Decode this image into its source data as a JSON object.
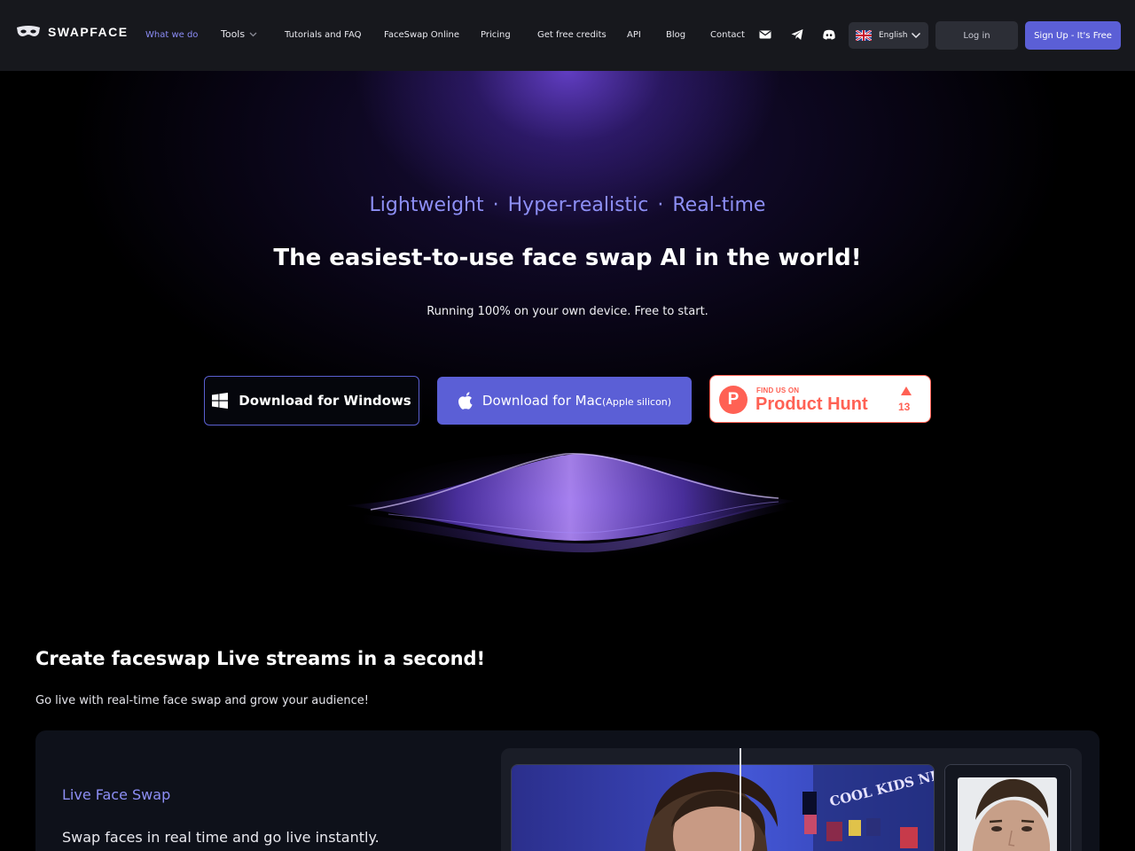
{
  "brand": {
    "name": "SWAPFACE",
    "accent": "#8d8ff5",
    "primary": "#5b5fd6"
  },
  "nav": {
    "links": [
      {
        "label": "What we do",
        "active": true
      },
      {
        "label": "Tools",
        "dropdown": true
      },
      {
        "label": "Tutorials and FAQ"
      },
      {
        "label": "FaceSwap Online"
      },
      {
        "label": "Pricing"
      },
      {
        "label": "Get free credits"
      },
      {
        "label": "API"
      },
      {
        "label": "Blog"
      },
      {
        "label": "Contact"
      }
    ],
    "icons": [
      "mail-icon",
      "telegram-icon",
      "discord-icon"
    ],
    "language": "English",
    "login": "Log in",
    "signup": "Sign Up - It's Free"
  },
  "hero": {
    "tagline": [
      "Lightweight",
      "Hyper-realistic",
      "Real-time"
    ],
    "tagline_separator": "·",
    "headline": "The easiest-to-use face swap AI in the world!",
    "subline": "Running 100% on your own device. Free to start.",
    "download_windows": "Download for Windows",
    "download_mac": "Download for Mac",
    "download_mac_sub": "(Apple silicon)",
    "product_hunt": {
      "small": "FIND US ON",
      "big": "Product Hunt",
      "count": "13"
    }
  },
  "live": {
    "title": "Create faceswap Live streams in a second!",
    "subtitle": "Go live with real-time face swap and grow your audience!",
    "feature_title": "Live Face Swap",
    "feature_desc": "Swap faces in real time and go live instantly.",
    "poster_text": "COOL KIDS NEVER"
  }
}
